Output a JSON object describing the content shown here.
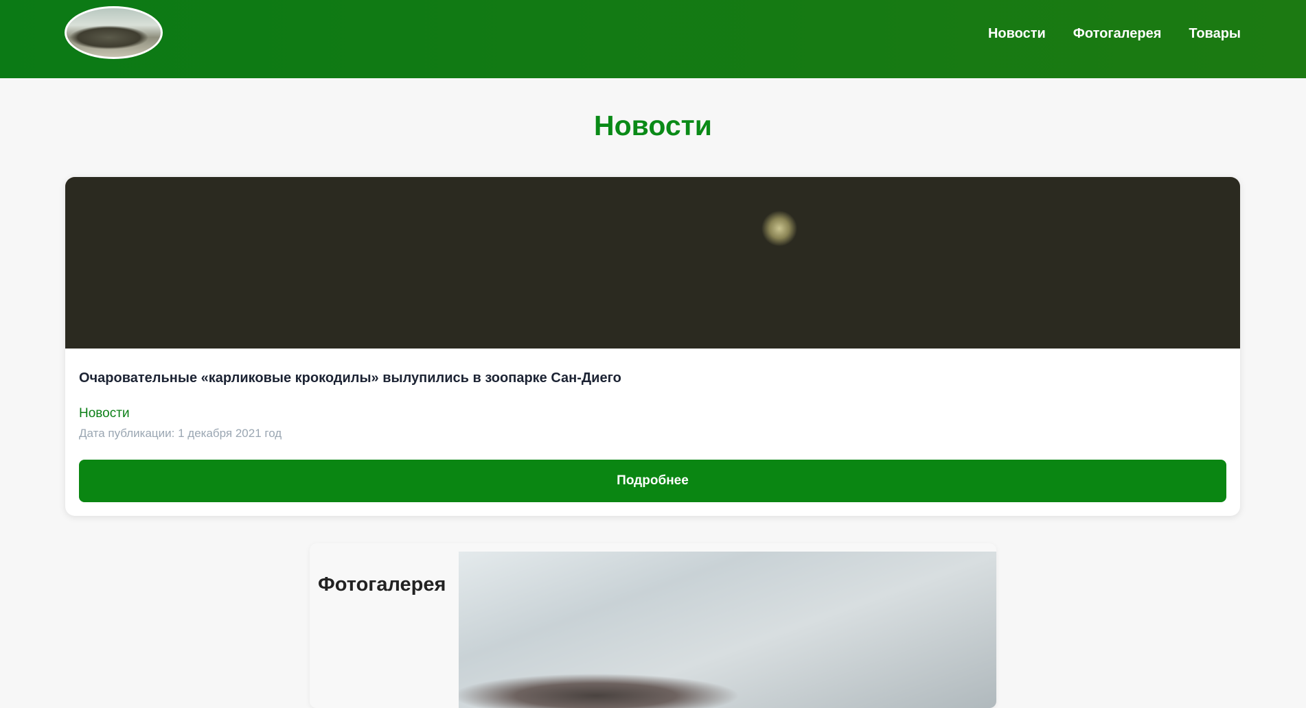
{
  "header": {
    "logo_alt": "logo",
    "nav": [
      {
        "label": "Новости"
      },
      {
        "label": "Фотогалерея"
      },
      {
        "label": "Товары"
      }
    ]
  },
  "page": {
    "title": "Новости"
  },
  "news_card": {
    "title": "Очаровательные «карликовые крокодилы» вылупились в зоопарке Сан-Диего",
    "category": "Новости",
    "date": "Дата публикации: 1 декабря 2021 год",
    "button_label": "Подробнее"
  },
  "gallery": {
    "title": "Фотогалерея"
  }
}
